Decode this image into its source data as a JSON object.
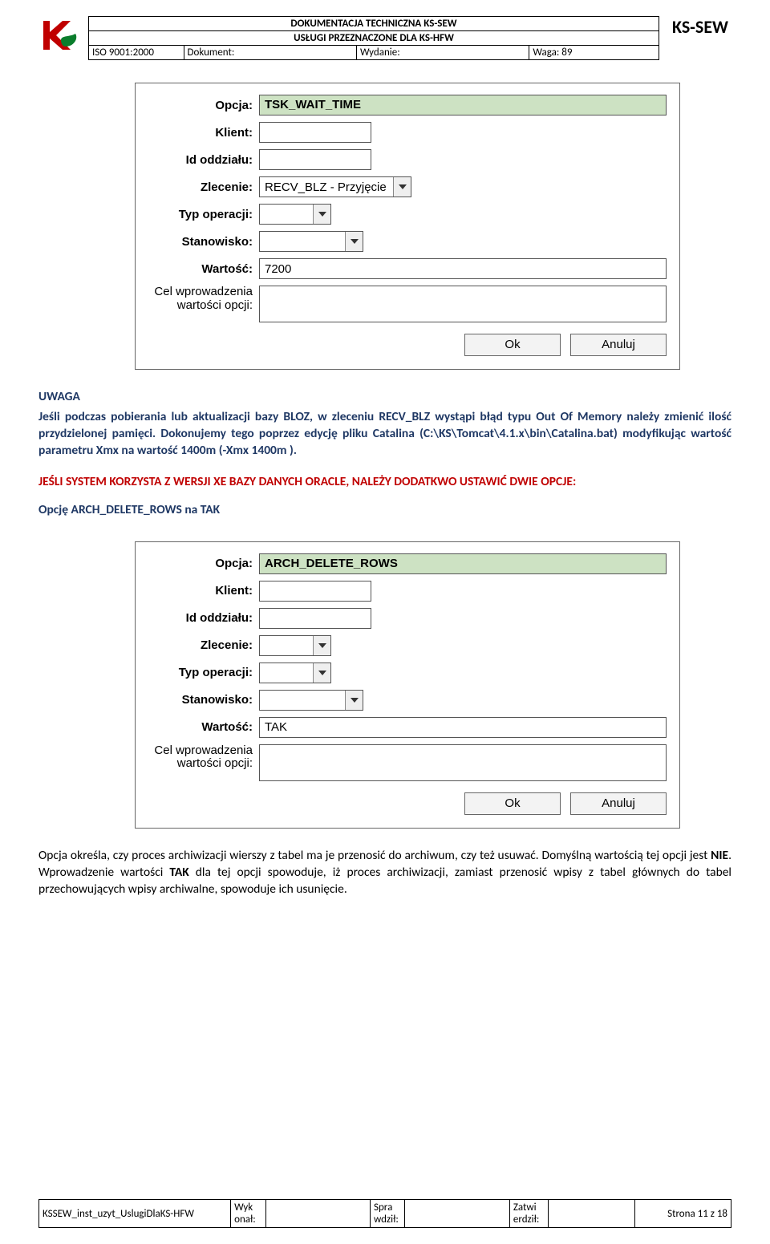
{
  "header": {
    "line1": "DOKUMENTACJA TECHNICZNA KS-SEW",
    "line2": "USŁUGI PRZEZNACZONE DLA KS-HFW",
    "iso": "ISO 9001:2000",
    "dokument_label": "Dokument:",
    "wydanie_label": "Wydanie:",
    "waga_label": "Waga: 89",
    "brand": "KS-SEW"
  },
  "form1": {
    "labels": {
      "opcja": "Opcja:",
      "klient": "Klient:",
      "id_oddzialu": "Id oddziału:",
      "zlecenie": "Zlecenie:",
      "typ_operacji": "Typ operacji:",
      "stanowisko": "Stanowisko:",
      "wartosc": "Wartość:",
      "cel": "Cel wprowadzenia wartości opcji:"
    },
    "values": {
      "opcja": "TSK_WAIT_TIME",
      "zlecenie": "RECV_BLZ - Przyjęcie",
      "wartosc": "7200"
    },
    "buttons": {
      "ok": "Ok",
      "anuluj": "Anuluj"
    }
  },
  "body": {
    "uwaga_title": "UWAGA",
    "uwaga_p1": "Jeśli podczas pobierania lub aktualizacji bazy BLOZ, w zleceniu RECV_BLZ wystąpi błąd typu Out Of Memory należy zmienić ilość przydzielonej pamięci. Dokonujemy tego poprzez edycję pliku Catalina (C:\\KS\\Tomcat\\4.1.x\\bin\\Catalina.bat) modyfikując wartość parametru Xmx na wartość 1400m (-Xmx 1400m ).",
    "red_line": "JEŚLI SYSTEM KORZYSTA Z WERSJI XE BAZY DANYCH ORACLE, NALEŻY DODATKWO USTAWIĆ DWIE OPCJE:",
    "opcje_line": "Opcję ARCH_DELETE_ROWS na TAK",
    "black_p_prefix": "Opcja określa, czy proces archiwizacji wierszy z tabel ma je przenosić do archiwum, czy też usuwać. Domyślną wartością tej opcji jest ",
    "black_b1": "NIE",
    "black_mid": ". Wprowadzenie wartości ",
    "black_b2": "TAK",
    "black_suffix": " dla tej opcji spowoduje, iż proces archiwizacji, zamiast przenosić wpisy z tabel głównych do tabel przechowujących wpisy archiwalne, spowoduje ich usunięcie."
  },
  "form2": {
    "values": {
      "opcja": "ARCH_DELETE_ROWS",
      "wartosc": "TAK"
    }
  },
  "footer": {
    "docid": "KSSEW_inst_uzyt_UslugiDlaKS-HFW",
    "wyk": "Wyk\nonał:",
    "spra": "Spra\nwdził:",
    "zatw": "Zatwi\nerdził:",
    "page": "Strona 11 z 18"
  }
}
